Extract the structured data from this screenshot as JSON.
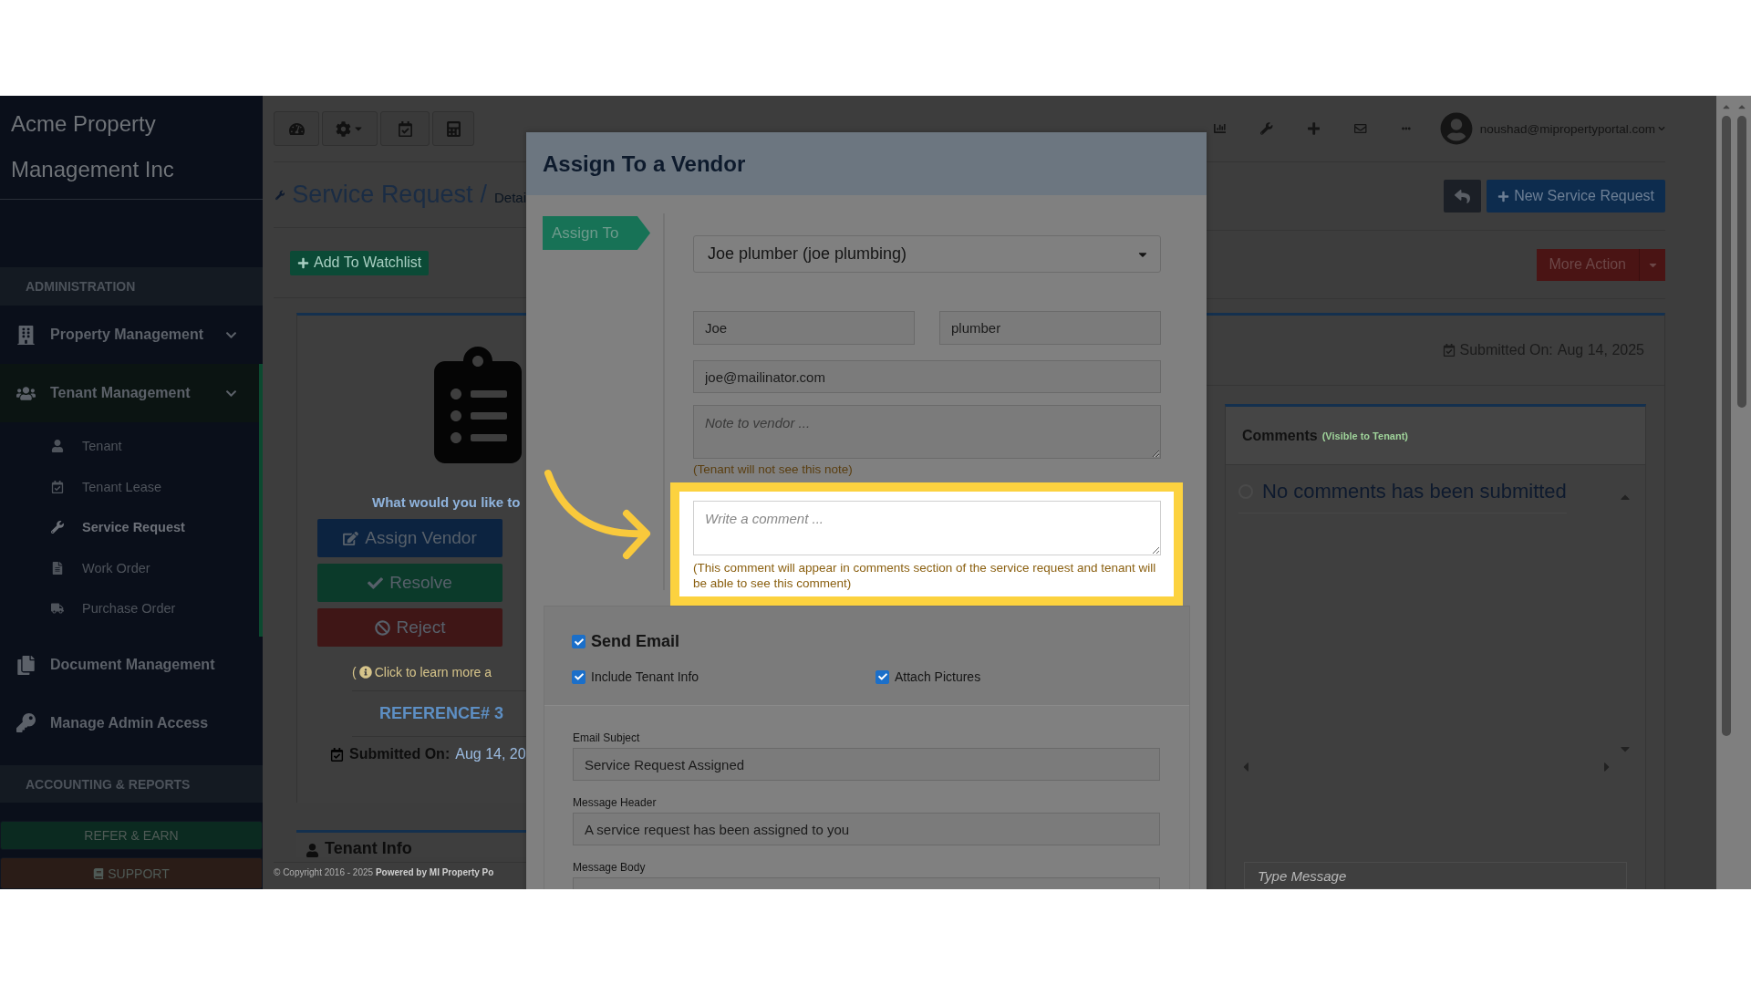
{
  "brand": {
    "line1": "Acme Property",
    "line2": "Management Inc"
  },
  "sidebar": [
    {
      "kind": "header",
      "label": "ADMINISTRATION"
    },
    {
      "kind": "group",
      "label": "Property Management",
      "expanded": false
    },
    {
      "kind": "group",
      "label": "Tenant Management",
      "expanded": true,
      "children": [
        {
          "label": "Tenant",
          "selected": false
        },
        {
          "label": "Tenant Lease",
          "selected": false
        },
        {
          "label": "Service Request",
          "selected": true
        },
        {
          "label": "Work Order",
          "selected": false
        },
        {
          "label": "Purchase Order",
          "selected": false
        }
      ]
    },
    {
      "kind": "item",
      "label": "Document Management"
    },
    {
      "kind": "item",
      "label": "Manage Admin Access"
    },
    {
      "kind": "header",
      "label": "ACCOUNTING & REPORTS"
    }
  ],
  "sidebar_buttons": [
    {
      "kind": "refer",
      "label": "REFER & EARN"
    },
    {
      "kind": "support",
      "label": "SUPPORT"
    }
  ],
  "page": {
    "title": "Service Request",
    "separator": "/",
    "subtitle": "Detai",
    "watchlist": "Add To Watchlist"
  },
  "request_card": {
    "prompt": "What would you like to",
    "actions": [
      {
        "kind": "assign",
        "label": "Assign Vendor"
      },
      {
        "kind": "resolve",
        "label": "Resolve"
      },
      {
        "kind": "reject",
        "label": "Reject"
      }
    ],
    "learn_more_open": "(",
    "learn_more": "Click to learn more a",
    "reference": "REFERENCE# 3",
    "submitted_label": "Submitted On:",
    "submitted_value": "Aug 14, 20"
  },
  "tenant_info": "Tenant Info",
  "footer": {
    "copyright": "© Copyright 2016 - 2025",
    "powered": "Powered by MI Property Po"
  },
  "user": "noushad@mipropertyportal.com",
  "header_buttons": {
    "new_request": "New Service Request",
    "more_action": "More Action"
  },
  "detail": {
    "submitted_label": "Submitted On:",
    "submitted_value": "Aug 14, 2025"
  },
  "comments": {
    "title": "Comments",
    "note": "(Visible to Tenant)",
    "empty": "No comments has been submitted",
    "placeholder": "Type Message"
  },
  "modal": {
    "title": "Assign To a Vendor",
    "assign_label": "Assign To",
    "vendor": "Joe plumber (joe plumbing)",
    "first_name": "Joe",
    "last_name": "plumber",
    "email": "joe@mailinator.com",
    "note_placeholder": "Note to vendor ...",
    "note_hint": "(Tenant will not see this note)",
    "comment_placeholder": "Write a comment ...",
    "comment_hint": "(This comment will appear in comments section of the service request and tenant will be able to see this comment)",
    "send_email": {
      "label": "Send Email",
      "checked": true
    },
    "options": [
      {
        "label": "Include Tenant Info",
        "checked": true
      },
      {
        "label": "Attach Pictures",
        "checked": true
      }
    ],
    "fields": [
      {
        "label": "Email Subject",
        "value": "Service Request Assigned"
      },
      {
        "label": "Message Header",
        "value": "A service request has been assigned to you"
      },
      {
        "label": "Message Body"
      }
    ]
  }
}
